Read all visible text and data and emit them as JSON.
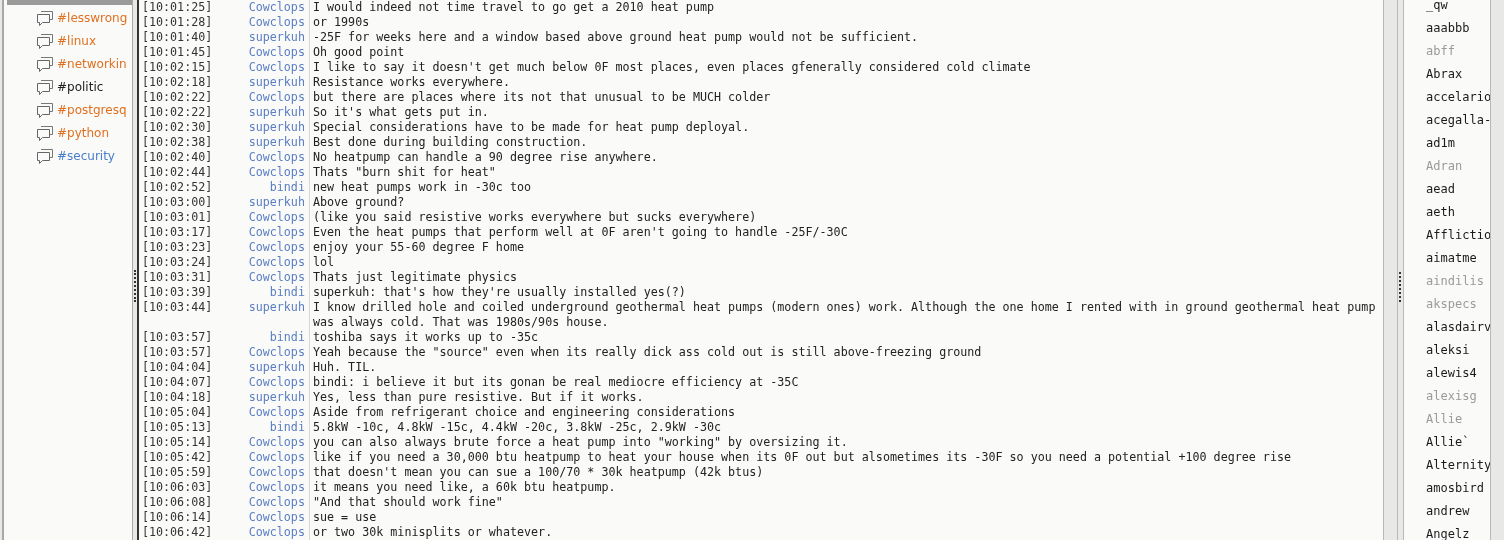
{
  "channels": [
    {
      "label": "#lesswrong",
      "color": "#e0701f"
    },
    {
      "label": "#linux",
      "color": "#e0701f"
    },
    {
      "label": "#networkin",
      "color": "#e0701f"
    },
    {
      "label": "#politic",
      "color": "#222222"
    },
    {
      "label": "#postgresq",
      "color": "#e0701f"
    },
    {
      "label": "#python",
      "color": "#e0701f"
    },
    {
      "label": "#security",
      "color": "#4a7ec8"
    }
  ],
  "messages": [
    {
      "time": "[10:01:25]",
      "nick": "Cowclops",
      "text": "I would indeed not time travel to go get a 2010 heat pump"
    },
    {
      "time": "[10:01:28]",
      "nick": "Cowclops",
      "text": "or 1990s"
    },
    {
      "time": "[10:01:40]",
      "nick": "superkuh",
      "text": "-25F for weeks here and a window based above ground heat pump would not be sufficient."
    },
    {
      "time": "[10:01:45]",
      "nick": "Cowclops",
      "text": "Oh good point"
    },
    {
      "time": "[10:02:15]",
      "nick": "Cowclops",
      "text": "I like to say it doesn't get much below 0F most places, even places gfenerally considered cold climate"
    },
    {
      "time": "[10:02:18]",
      "nick": "superkuh",
      "text": "Resistance works everywhere."
    },
    {
      "time": "[10:02:22]",
      "nick": "Cowclops",
      "text": "but there are places where its not that unusual to be MUCH colder"
    },
    {
      "time": "[10:02:22]",
      "nick": "superkuh",
      "text": "So it's what gets put in."
    },
    {
      "time": "[10:02:30]",
      "nick": "superkuh",
      "text": "Special considerations have to be made for heat pump deployal."
    },
    {
      "time": "[10:02:38]",
      "nick": "superkuh",
      "text": "Best done during building construction."
    },
    {
      "time": "[10:02:40]",
      "nick": "Cowclops",
      "text": "No heatpump can handle a 90 degree rise anywhere."
    },
    {
      "time": "[10:02:44]",
      "nick": "Cowclops",
      "text": "Thats \"burn shit for heat\""
    },
    {
      "time": "[10:02:52]",
      "nick": "bindi",
      "text": "new heat pumps work in -30c too"
    },
    {
      "time": "[10:03:00]",
      "nick": "superkuh",
      "text": "Above ground?"
    },
    {
      "time": "[10:03:01]",
      "nick": "Cowclops",
      "text": "(like you said resistive works everywhere but sucks everywhere)"
    },
    {
      "time": "[10:03:17]",
      "nick": "Cowclops",
      "text": "Even the heat pumps that perform well at 0F aren't going to handle -25F/-30C"
    },
    {
      "time": "[10:03:23]",
      "nick": "Cowclops",
      "text": "enjoy your 55-60 degree F home"
    },
    {
      "time": "[10:03:24]",
      "nick": "Cowclops",
      "text": "lol"
    },
    {
      "time": "[10:03:31]",
      "nick": "Cowclops",
      "text": "Thats just legitimate physics"
    },
    {
      "time": "[10:03:39]",
      "nick": "bindi",
      "text": "superkuh: that's how they're usually installed yes(?)"
    },
    {
      "time": "[10:03:44]",
      "nick": "superkuh",
      "text": "I know drilled hole and coiled underground geothermal heat pumps (modern ones) work. Although the one home I rented with in ground geothermal heat pump was always cold. That was 1980s/90s house."
    },
    {
      "time": "[10:03:57]",
      "nick": "bindi",
      "text": "toshiba says it works up to -35c"
    },
    {
      "time": "[10:03:57]",
      "nick": "Cowclops",
      "text": "Yeah because the \"source\" even when its really dick ass cold out is still above-freezing ground"
    },
    {
      "time": "[10:04:04]",
      "nick": "superkuh",
      "text": "Huh. TIL."
    },
    {
      "time": "[10:04:07]",
      "nick": "Cowclops",
      "text": "bindi: i believe it but its gonan be real mediocre efficiency at -35C"
    },
    {
      "time": "[10:04:18]",
      "nick": "superkuh",
      "text": "Yes, less than pure resistive. But if it works."
    },
    {
      "time": "[10:05:04]",
      "nick": "Cowclops",
      "text": "Aside from refrigerant choice and engineering considerations"
    },
    {
      "time": "[10:05:13]",
      "nick": "bindi",
      "text": "5.8kW -10c, 4.8kW -15c, 4.4kW -20c, 3.8kW -25c, 2.9kW -30c"
    },
    {
      "time": "[10:05:14]",
      "nick": "Cowclops",
      "text": "you can also always brute force a heat pump into \"working\" by oversizing it."
    },
    {
      "time": "[10:05:42]",
      "nick": "Cowclops",
      "text": "like if you need a 30,000 btu heatpump to heat your house when its 0F out but alsometimes its -30F so you need a potential +100 degree rise"
    },
    {
      "time": "[10:05:59]",
      "nick": "Cowclops",
      "text": "that doesn't mean you can sue a 100/70 * 30k heatpump (42k btus)"
    },
    {
      "time": "[10:06:03]",
      "nick": "Cowclops",
      "text": "it means you need like, a 60k btu heatpump."
    },
    {
      "time": "[10:06:08]",
      "nick": "Cowclops",
      "text": "\"And that should work fine\""
    },
    {
      "time": "[10:06:14]",
      "nick": "Cowclops",
      "text": "sue = use"
    },
    {
      "time": "[10:06:42]",
      "nick": "Cowclops",
      "text": "or two 30k minisplits or whatever."
    }
  ],
  "users": [
    {
      "nick": "_qw",
      "away": false
    },
    {
      "nick": "aaabbb",
      "away": false
    },
    {
      "nick": "abff",
      "away": true
    },
    {
      "nick": "Abrax",
      "away": false
    },
    {
      "nick": "accelario",
      "away": false
    },
    {
      "nick": "acegalla-",
      "away": false
    },
    {
      "nick": "ad1m",
      "away": false
    },
    {
      "nick": "Adran",
      "away": true
    },
    {
      "nick": "aead",
      "away": false
    },
    {
      "nick": "aeth",
      "away": false
    },
    {
      "nick": "Afflictio",
      "away": false
    },
    {
      "nick": "aimatme",
      "away": false
    },
    {
      "nick": "aindilis",
      "away": true
    },
    {
      "nick": "akspecs",
      "away": true
    },
    {
      "nick": "alasdairv",
      "away": false
    },
    {
      "nick": "aleksi",
      "away": false
    },
    {
      "nick": "alewis4",
      "away": false
    },
    {
      "nick": "alexisg",
      "away": true
    },
    {
      "nick": "Allie",
      "away": true
    },
    {
      "nick": "Allie`",
      "away": false
    },
    {
      "nick": "Alternity",
      "away": false
    },
    {
      "nick": "amosbird",
      "away": false
    },
    {
      "nick": "andrew",
      "away": false
    },
    {
      "nick": "Angelz",
      "away": false
    }
  ]
}
